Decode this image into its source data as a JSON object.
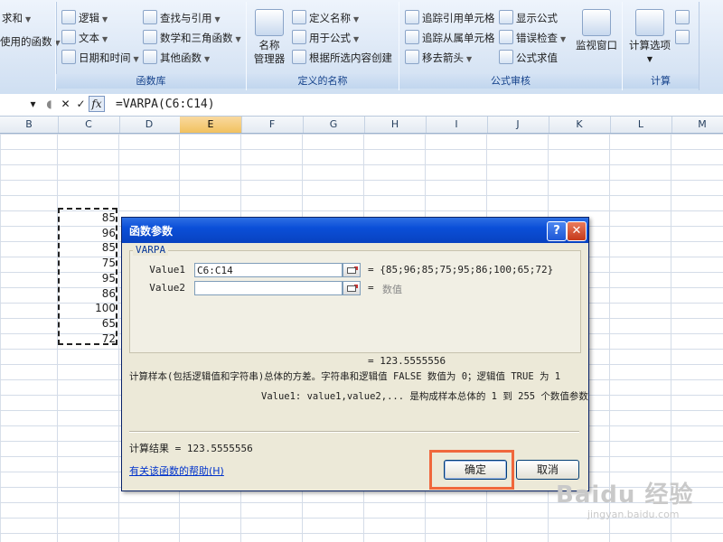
{
  "ribbon": {
    "col0": {
      "item1": "求和",
      "item2": "使用的函数"
    },
    "library": {
      "col1": [
        "逻辑",
        "文本",
        "日期和时间"
      ],
      "col2": [
        "查找与引用",
        "数学和三角函数",
        "其他函数"
      ],
      "label": "函数库"
    },
    "names": {
      "big_label_1": "名称",
      "big_label_2": "管理器",
      "items": [
        "定义名称",
        "用于公式",
        "根据所选内容创建"
      ],
      "label": "定义的名称"
    },
    "audit": {
      "col1": [
        "追踪引用单元格",
        "追踪从属单元格",
        "移去箭头"
      ],
      "col2": [
        "显示公式",
        "错误检查",
        "公式求值"
      ],
      "watch_label": "监视窗口",
      "label": "公式审核"
    },
    "calc": {
      "big_label": "计算选项",
      "label": "计算"
    }
  },
  "formula_bar": {
    "fx_label": "fx",
    "formula": "=VARPA(C6:C14)"
  },
  "columns": [
    "B",
    "C",
    "D",
    "E",
    "F",
    "G",
    "H",
    "I",
    "J",
    "K",
    "L",
    "M"
  ],
  "active_column": "E",
  "cells": {
    "column": "C",
    "values": [
      "85",
      "96",
      "85",
      "75",
      "95",
      "86",
      "100",
      "65",
      "72"
    ]
  },
  "dialog": {
    "title": "函数参数",
    "help_glyph": "?",
    "close_glyph": "✕",
    "function_name": "VARPA",
    "args": [
      {
        "label": "Value1",
        "value": "C6:C14",
        "result": "= {85;96;85;75;95;86;100;65;72}"
      },
      {
        "label": "Value2",
        "value": "",
        "result_prefix": "=",
        "result": "数值"
      }
    ],
    "result_line": "= 123.5555556",
    "description": "计算样本(包括逻辑值和字符串)总体的方差。字符串和逻辑值 FALSE 数值为 0；逻辑值 TRUE 为 1",
    "arg_help": "Value1:  value1,value2,... 是构成样本总体的 1 到 255 个数值参数",
    "calc_result": "计算结果 =  123.5555556",
    "help_link": "有关该函数的帮助(H)",
    "ok": "确定",
    "cancel": "取消"
  },
  "watermark": {
    "brand": "Baidu 经验",
    "url": "jingyan.baidu.com"
  }
}
